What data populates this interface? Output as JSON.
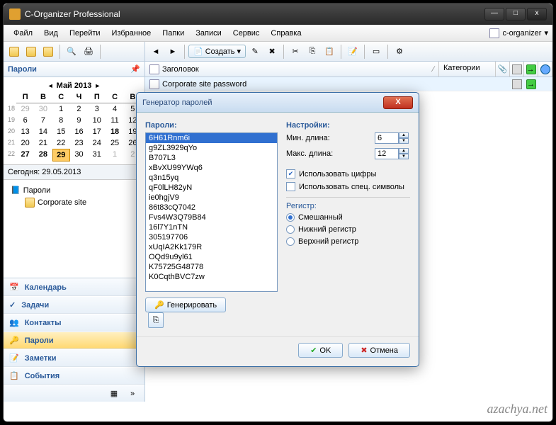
{
  "app": {
    "title": "C-Organizer Professional"
  },
  "menu": [
    "Файл",
    "Вид",
    "Перейти",
    "Избранное",
    "Папки",
    "Записи",
    "Сервис",
    "Справка"
  ],
  "right_menu": "c-organizer",
  "toolbar_main": {
    "create": "Создать"
  },
  "left": {
    "panel_title": "Пароли",
    "calendar": {
      "title": "Май 2013",
      "dow": [
        "П",
        "В",
        "С",
        "Ч",
        "П",
        "С",
        "В"
      ],
      "weeks": [
        {
          "n": 18,
          "d": [
            {
              "v": 29,
              "o": 1
            },
            {
              "v": 30,
              "o": 1
            },
            {
              "v": 1
            },
            {
              "v": 2
            },
            {
              "v": 3
            },
            {
              "v": 4
            },
            {
              "v": 5
            }
          ]
        },
        {
          "n": 19,
          "d": [
            {
              "v": 6
            },
            {
              "v": 7
            },
            {
              "v": 8
            },
            {
              "v": 9
            },
            {
              "v": 10
            },
            {
              "v": 11
            },
            {
              "v": 12
            }
          ]
        },
        {
          "n": 20,
          "d": [
            {
              "v": 13
            },
            {
              "v": 14
            },
            {
              "v": 15
            },
            {
              "v": 16
            },
            {
              "v": 17
            },
            {
              "v": 18,
              "b": 1
            },
            {
              "v": 19
            }
          ]
        },
        {
          "n": 21,
          "d": [
            {
              "v": 20
            },
            {
              "v": 21
            },
            {
              "v": 22
            },
            {
              "v": 23
            },
            {
              "v": 24
            },
            {
              "v": 25
            },
            {
              "v": 26
            }
          ]
        },
        {
          "n": 22,
          "d": [
            {
              "v": 27,
              "b": 1
            },
            {
              "v": 28,
              "b": 1
            },
            {
              "v": 29,
              "t": 1
            },
            {
              "v": 30
            },
            {
              "v": 31
            },
            {
              "v": 1,
              "o": 1
            },
            {
              "v": 2,
              "o": 1
            }
          ]
        }
      ]
    },
    "today_label": "Сегодня:",
    "today_date": "29.05.2013",
    "tree": {
      "root": "Пароли",
      "child": "Corporate site"
    },
    "nav": [
      "Календарь",
      "Задачи",
      "Контакты",
      "Пароли",
      "Заметки",
      "События"
    ],
    "nav_active": 3
  },
  "grid": {
    "cols": {
      "title": "Заголовок",
      "category": "Категории"
    },
    "rows": [
      {
        "title": "Corporate site password"
      }
    ]
  },
  "dialog": {
    "title": "Генератор паролей",
    "passwords_label": "Пароли:",
    "settings_label": "Настройки:",
    "passwords": [
      "6H61Rnm6i",
      "g9ZL3929qYo",
      "B707L3",
      "xBvXU99YWq6",
      "q3n15yq",
      "qF0lLH82yN",
      "ie0hgjV9",
      "86t83cQ7042",
      "Fvs4W3Q79B84",
      "16l7Y1nTN",
      "305197706",
      "xUqIA2Kk179R",
      "OQd9u9yl61",
      "K75725G48778",
      "K0CqthBVC7zw"
    ],
    "selected": 0,
    "min_label": "Мин. длина:",
    "max_label": "Макс. длина:",
    "min_val": "6",
    "max_val": "12",
    "use_digits": "Использовать цифры",
    "use_special": "Использовать спец. символы",
    "case_label": "Регистр:",
    "case_opts": [
      "Смешанный",
      "Нижний регистр",
      "Верхний регистр"
    ],
    "case_sel": 0,
    "generate": "Генерировать",
    "ok": "OK",
    "cancel": "Отмена"
  },
  "watermark": "azachya.net"
}
